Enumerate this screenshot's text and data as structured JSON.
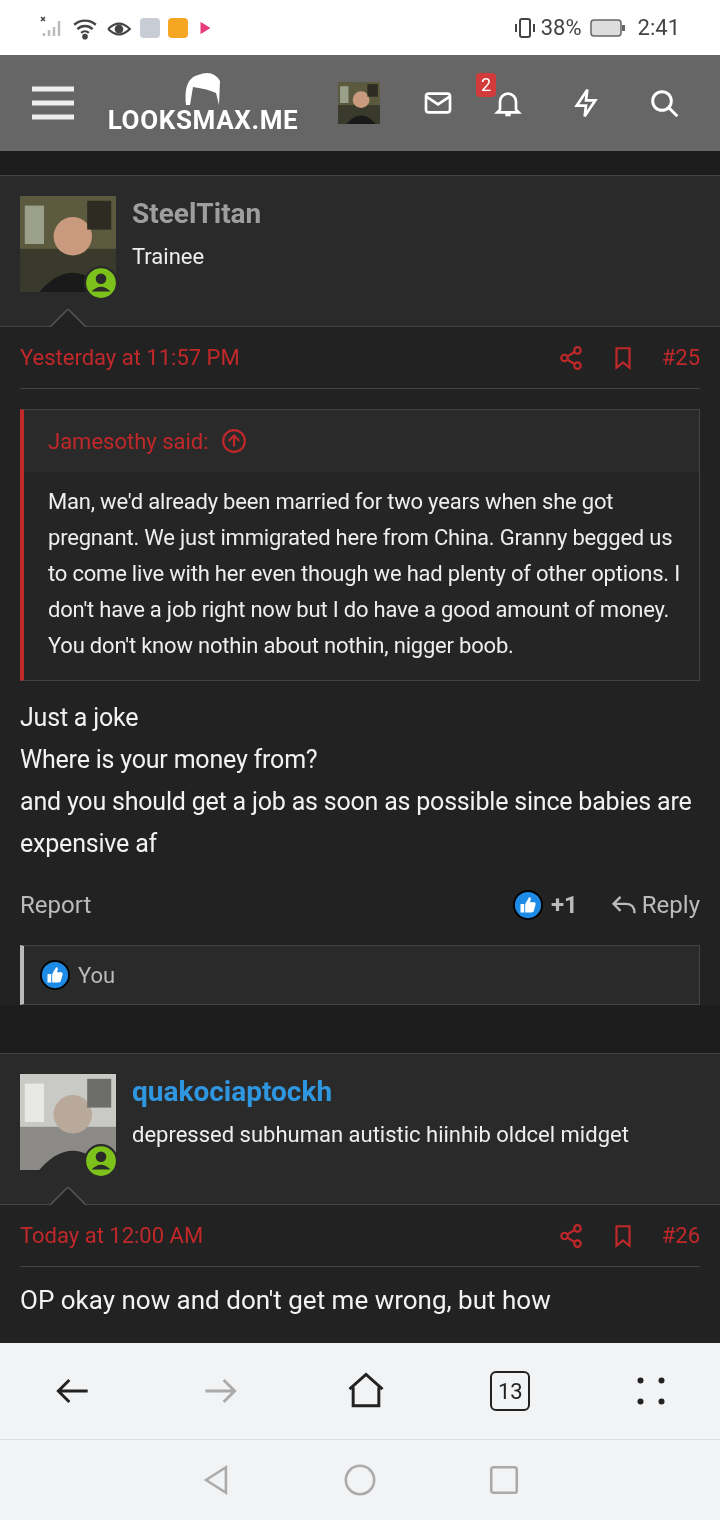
{
  "status_bar": {
    "battery": "38%",
    "time": "2:41"
  },
  "header": {
    "logo": "LOOKSMAX.ME",
    "notification_count": "2"
  },
  "posts": [
    {
      "author": "SteelTitan",
      "color": "#9e9e9e",
      "title": "Trainee",
      "time": "Yesterday at 11:57 PM",
      "number": "#25",
      "quote": {
        "author": "Jamesothy said:",
        "text": "Man, we'd already been married for two years when she got pregnant. We just immigrated here from China. Granny begged us to come live with her even though we had plenty of other options. I don't have a job right now but I do have a good amount of money. You don't know nothin about nothin, nigger boob."
      },
      "body": [
        "Just a joke",
        "Where is your money from?",
        "and you should get a job as soon as possible since babies are expensive af"
      ],
      "actions": {
        "report": "Report",
        "likes": "+1",
        "reply": "Reply"
      },
      "reactions": "You"
    },
    {
      "author": "quakociaptockh",
      "color": "#2f96e0",
      "title": "depressed subhuman autistic hiinhib oldcel midget",
      "time": "Today at 12:00 AM",
      "number": "#26",
      "body": [
        "OP okay now and don't get me wrong, but how"
      ]
    }
  ],
  "browser": {
    "tabs_count": "13",
    "forward_disabled": true
  }
}
